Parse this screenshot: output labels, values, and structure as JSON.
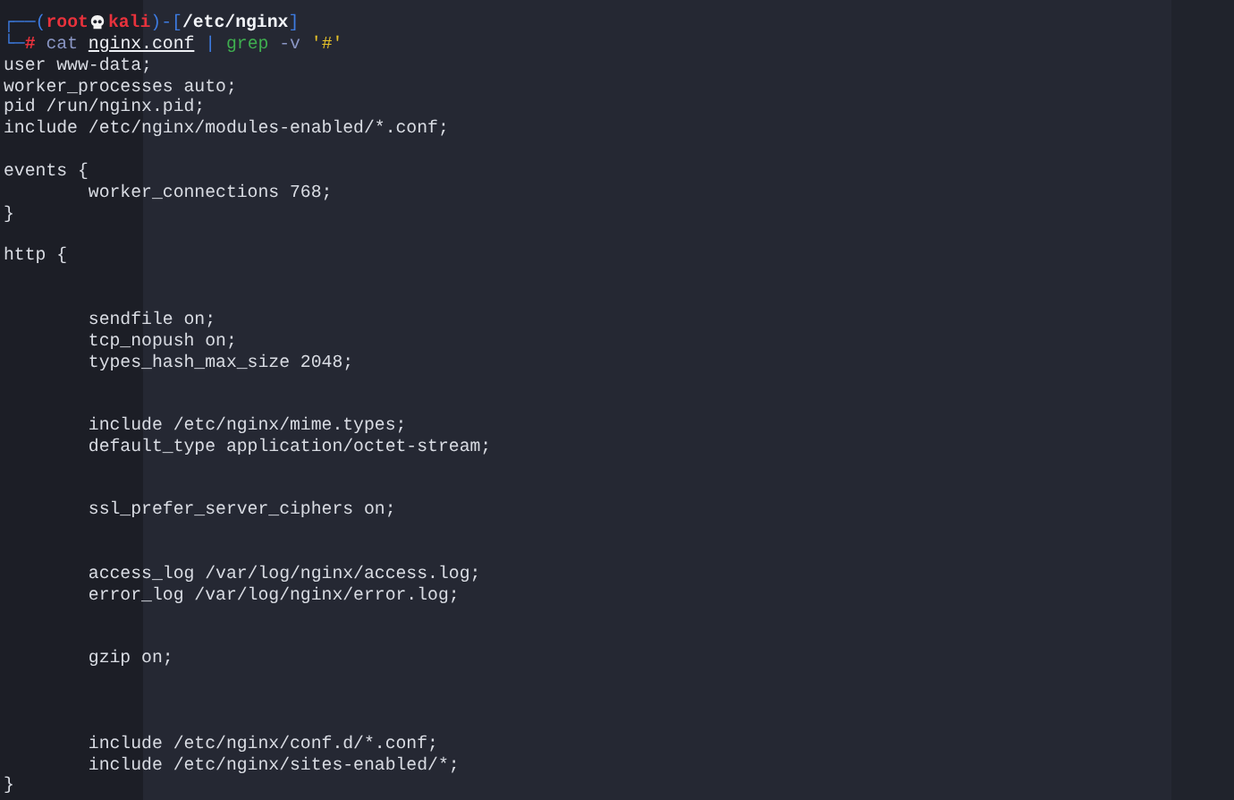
{
  "prompt": {
    "header": [
      {
        "kind": "frame",
        "text": "┌──("
      },
      {
        "kind": "user",
        "text": "root"
      },
      {
        "kind": "icon"
      },
      {
        "kind": "host",
        "text": "kali"
      },
      {
        "kind": "frame",
        "text": ")-["
      },
      {
        "kind": "path",
        "text": "/etc/nginx"
      },
      {
        "kind": "frame",
        "text": "]"
      }
    ],
    "command": [
      {
        "kind": "frame",
        "text": "└─"
      },
      {
        "kind": "symbol",
        "text": "#"
      },
      {
        "kind": "command",
        "text": "cat",
        "space_before": true
      },
      {
        "kind": "file",
        "text": "nginx.conf",
        "space_before": true
      },
      {
        "kind": "frame",
        "text": "|",
        "space_before": true
      },
      {
        "kind": "pipe_command",
        "text": "grep",
        "space_before": true
      },
      {
        "kind": "option",
        "text": "-v",
        "space_before": true
      },
      {
        "kind": "string",
        "text": "'#'",
        "space_before": true
      }
    ]
  },
  "output": [
    {
      "kind": "text",
      "text": "user www-data;"
    },
    {
      "kind": "text",
      "text": "worker_processes auto;"
    },
    {
      "kind": "text",
      "text": "pid /run/nginx.pid;"
    },
    {
      "kind": "text",
      "text": "include /etc/nginx/modules-enabled/*.conf;"
    },
    {
      "kind": "blank"
    },
    {
      "kind": "text",
      "text": "events {"
    },
    {
      "kind": "text",
      "text": "        worker_connections 768;"
    },
    {
      "kind": "text",
      "text": "}"
    },
    {
      "kind": "blank"
    },
    {
      "kind": "text",
      "text": "http {"
    },
    {
      "kind": "blank"
    },
    {
      "kind": "blank"
    },
    {
      "kind": "text",
      "text": "        sendfile on;"
    },
    {
      "kind": "text",
      "text": "        tcp_nopush on;"
    },
    {
      "kind": "text",
      "text": "        types_hash_max_size 2048;"
    },
    {
      "kind": "blank"
    },
    {
      "kind": "blank"
    },
    {
      "kind": "text",
      "text": "        include /etc/nginx/mime.types;"
    },
    {
      "kind": "text",
      "text": "        default_type application/octet-stream;"
    },
    {
      "kind": "blank"
    },
    {
      "kind": "blank"
    },
    {
      "kind": "text",
      "text": "        ssl_prefer_server_ciphers on;"
    },
    {
      "kind": "blank"
    },
    {
      "kind": "blank"
    },
    {
      "kind": "text",
      "text": "        access_log /var/log/nginx/access.log;"
    },
    {
      "kind": "text",
      "text": "        error_log /var/log/nginx/error.log;"
    },
    {
      "kind": "blank"
    },
    {
      "kind": "blank"
    },
    {
      "kind": "text",
      "text": "        gzip on;"
    },
    {
      "kind": "blank"
    },
    {
      "kind": "blank"
    },
    {
      "kind": "blank"
    },
    {
      "kind": "text",
      "text": "        include /etc/nginx/conf.d/*.conf;"
    },
    {
      "kind": "text",
      "text": "        include /etc/nginx/sites-enabled/*;"
    },
    {
      "kind": "text",
      "text": "}"
    }
  ]
}
